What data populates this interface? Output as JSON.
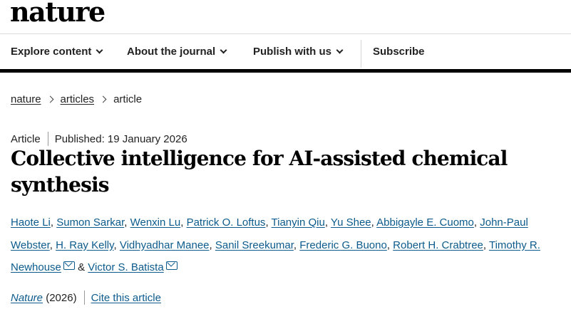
{
  "site": {
    "logo_text": "nature"
  },
  "nav": {
    "explore": "Explore content",
    "about": "About the journal",
    "publish": "Publish with us",
    "subscribe": "Subscribe"
  },
  "breadcrumb": [
    "nature",
    "articles",
    "article"
  ],
  "article": {
    "type": "Article",
    "published": "Published: 19 January 2026",
    "title": "Collective intelligence for AI-assisted chemical synthesis",
    "authors": [
      "Haote Li",
      "Sumon Sarkar",
      "Wenxin Lu",
      "Patrick O. Loftus",
      "Tianyin Qiu",
      "Yu Shee",
      "Abbigayle E. Cuomo",
      "John-Paul Webster",
      "H. Ray Kelly",
      "Vidhyadhar Manee",
      "Sanil Sreekumar",
      "Frederic G. Buono",
      "Robert H. Crabtree",
      "Timothy R. Newhouse",
      "Victor S. Batista"
    ],
    "author_separator": ",",
    "author_conjunction": "&",
    "journal": "Nature",
    "year": "(2026)",
    "cite_label": "Cite this article"
  }
}
